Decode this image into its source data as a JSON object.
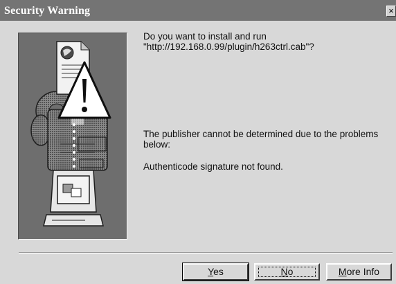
{
  "window": {
    "title": "Security Warning",
    "close_glyph": "×"
  },
  "message": {
    "question_line1": "Do you want to install and run",
    "question_line2": "\"http://192.168.0.99/plugin/h263ctrl.cab\"?",
    "publisher": "The publisher cannot be determined due to the problems below:",
    "reason": "Authenticode signature not found."
  },
  "buttons": {
    "yes": {
      "mnemonic": "Y",
      "rest": "es"
    },
    "no": {
      "mnemonic": "N",
      "rest": "o"
    },
    "more_info": {
      "mnemonic": "M",
      "rest": "ore Info"
    }
  },
  "icons": [
    "document-globe-icon",
    "warning-icon",
    "keys-icon",
    "computer-icon"
  ],
  "colors": {
    "titlebar": "#747474",
    "panel": "#6e6e6e",
    "dialog": "#d8d8d8"
  }
}
